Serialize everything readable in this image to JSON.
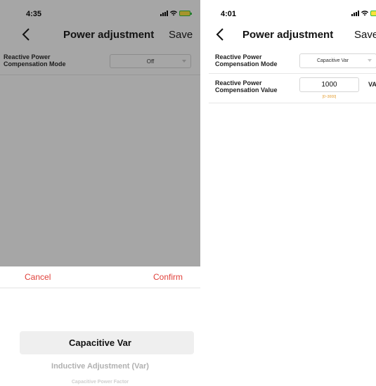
{
  "left_screen": {
    "status_bar": {
      "time": "4:35"
    },
    "nav": {
      "title": "Power adjustment",
      "save_label": "Save"
    },
    "mode_row": {
      "label_line1": "Reactive Power",
      "label_line2": "Compensation Mode",
      "value": "Off"
    },
    "picker": {
      "cancel_label": "Cancel",
      "confirm_label": "Confirm",
      "options": [
        "Capacitive Var",
        "Inductive Adjustment (Var)",
        "Capacitive Power Factor"
      ],
      "selected_index": 0
    }
  },
  "right_screen": {
    "status_bar": {
      "time": "4:01"
    },
    "nav": {
      "title": "Power adjustment",
      "save_label": "Save"
    },
    "mode_row": {
      "label_line1": "Reactive Power",
      "label_line2": "Compensation Mode",
      "value": "Capacitive Var"
    },
    "value_row": {
      "label_line1": "Reactive Power",
      "label_line2": "Compensation Value",
      "value": "1000",
      "unit": "VA",
      "range": "[0~3000]"
    }
  },
  "colors": {
    "accent_red": "#e0403a",
    "range_orange": "#e39a2a",
    "overlay": "rgba(20,20,20,0.38)"
  },
  "icons": [
    "back-chevron-icon",
    "signal-icon",
    "wifi-icon",
    "battery-icon",
    "chevron-down-icon"
  ]
}
